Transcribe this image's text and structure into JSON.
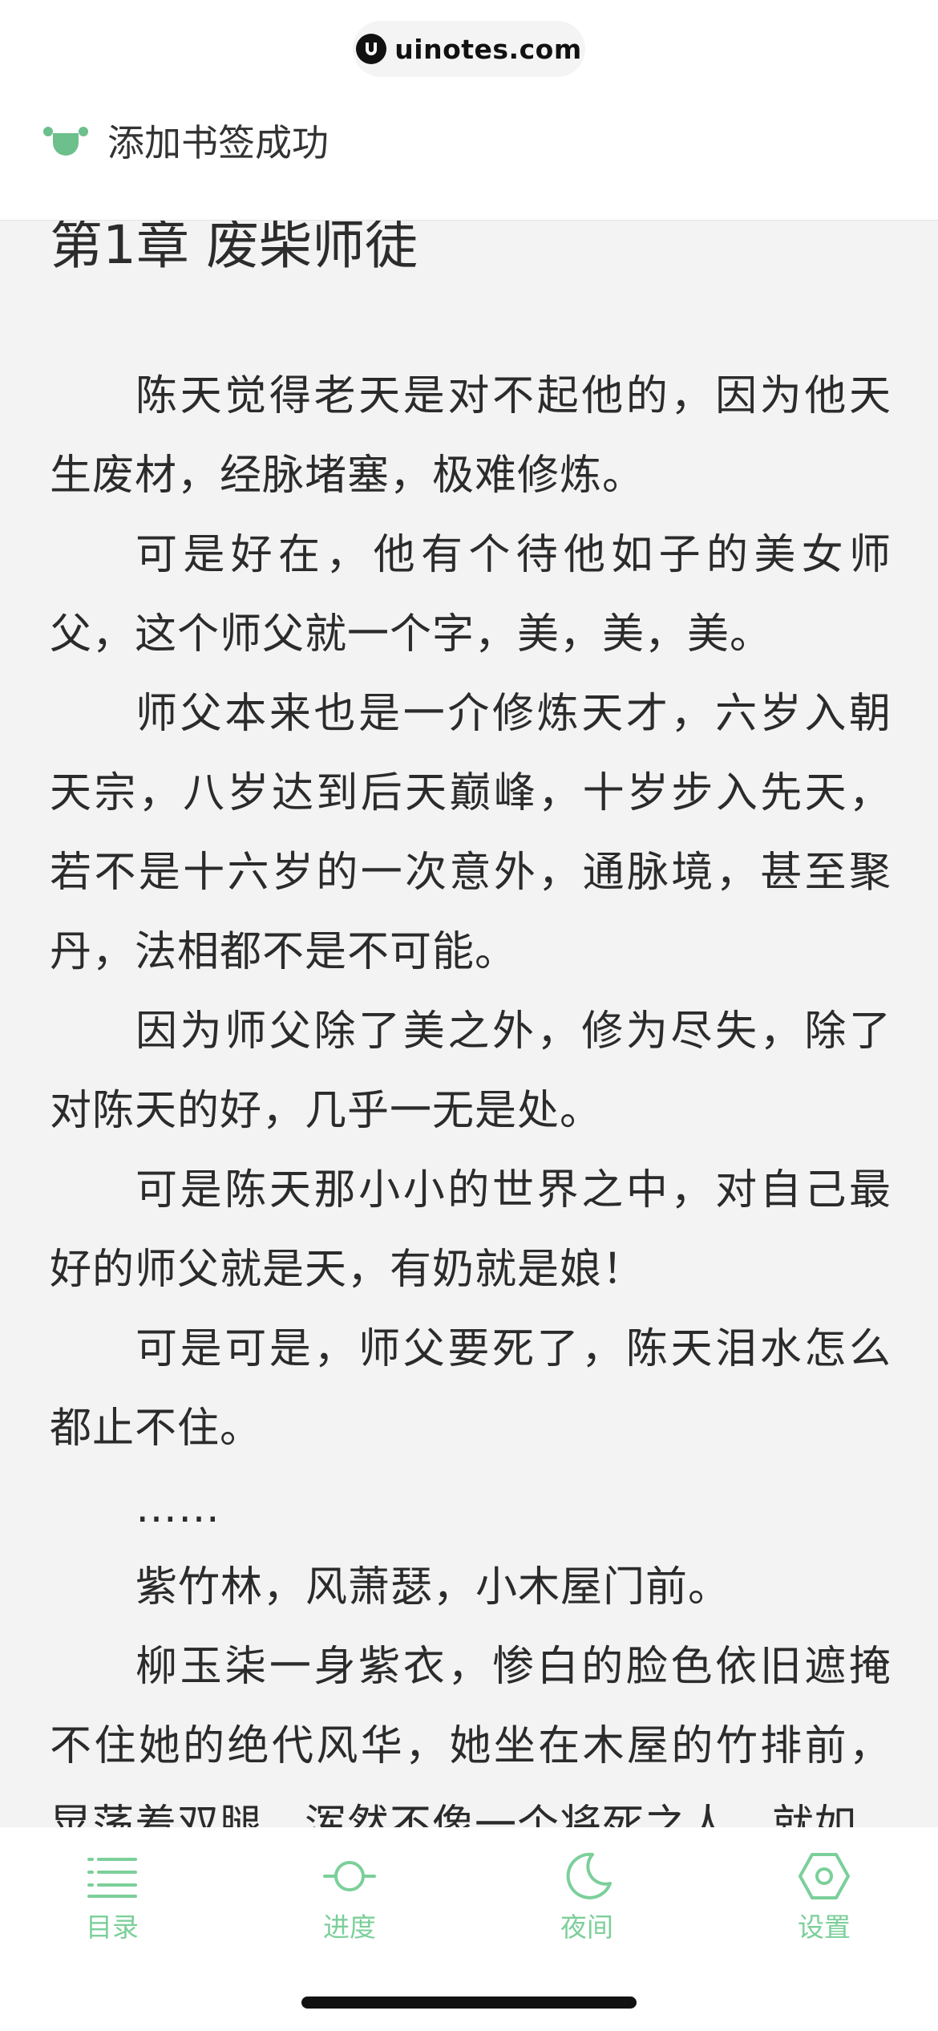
{
  "watermark": {
    "text": "uinotes.com"
  },
  "toast": {
    "text": "添加书签成功",
    "icon": "bookmark-face-icon"
  },
  "chapter": {
    "title": "第1章 废柴师徒",
    "paragraphs": [
      "陈天觉得老天是对不起他的，因为他天生废材，经脉堵塞，极难修炼。",
      "可是好在，他有个待他如子的美女师父，这个师父就一个字，美，美，美。",
      "师父本来也是一介修炼天才，六岁入朝天宗，八岁达到后天巅峰，十岁步入先天，若不是十六岁的一次意外，通脉境，甚至聚丹，法相都不是不可能。",
      "因为师父除了美之外，修为尽失，除了对陈天的好，几乎一无是处。",
      "可是陈天那小小的世界之中，对自己最好的师父就是天，有奶就是娘！",
      "可是可是，师父要死了，陈天泪水怎么都止不住。",
      "……",
      "紫竹林，风萧瑟，小木屋门前。",
      "柳玉柒一身紫衣，惨白的脸色依旧遮掩不住她的绝代风华，她坐在木屋的竹排前，晃荡着双腿，浑然不像一个将死之人，就如"
    ]
  },
  "toolbar": {
    "accent_color": "#7ccf9a",
    "items": [
      {
        "label": "目录",
        "icon": "list-icon"
      },
      {
        "label": "进度",
        "icon": "progress-icon"
      },
      {
        "label": "夜间",
        "icon": "moon-icon"
      },
      {
        "label": "设置",
        "icon": "settings-icon"
      }
    ]
  }
}
